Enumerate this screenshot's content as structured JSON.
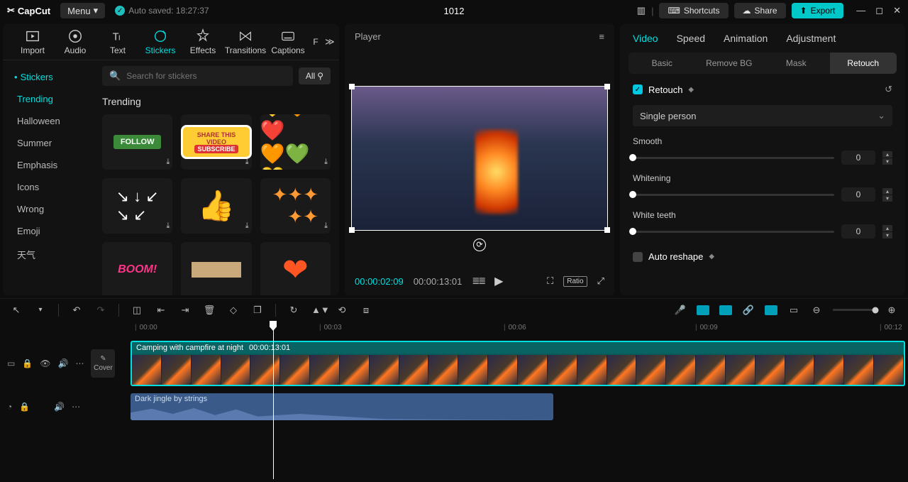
{
  "topbar": {
    "app": "CapCut",
    "menu": "Menu",
    "autosave": "Auto saved: 18:27:37",
    "project": "1012",
    "shortcuts": "Shortcuts",
    "share": "Share",
    "export": "Export"
  },
  "mediaTabs": {
    "import": "Import",
    "audio": "Audio",
    "text": "Text",
    "stickers": "Stickers",
    "effects": "Effects",
    "transitions": "Transitions",
    "captions": "Captions",
    "filters_initial": "F"
  },
  "stickers": {
    "root": "Stickers",
    "categories": [
      "Trending",
      "Halloween",
      "Summer",
      "Emphasis",
      "Icons",
      "Wrong",
      "Emoji",
      "天气"
    ],
    "search_placeholder": "Search for stickers",
    "filter": "All",
    "section": "Trending"
  },
  "player": {
    "title": "Player",
    "time_current": "00:00:02:09",
    "time_total": "00:00:13:01",
    "ratio": "Ratio"
  },
  "right": {
    "tabs": {
      "video": "Video",
      "speed": "Speed",
      "animation": "Animation",
      "adjustment": "Adjustment"
    },
    "subtabs": {
      "basic": "Basic",
      "removebg": "Remove BG",
      "mask": "Mask",
      "retouch": "Retouch"
    },
    "retouch_label": "Retouch",
    "person_mode": "Single person",
    "sliders": {
      "smooth": {
        "label": "Smooth",
        "value": "0"
      },
      "whitening": {
        "label": "Whitening",
        "value": "0"
      },
      "whiteteeth": {
        "label": "White teeth",
        "value": "0"
      }
    },
    "auto_reshape": "Auto reshape"
  },
  "timeline": {
    "marks": [
      "00:00",
      "00:03",
      "00:06",
      "00:09",
      "00:12"
    ],
    "cover": "Cover",
    "video_clip": {
      "name": "Camping with campfire at night",
      "duration": "00:00:13:01"
    },
    "audio_clip": {
      "name": "Dark jingle by strings"
    }
  }
}
